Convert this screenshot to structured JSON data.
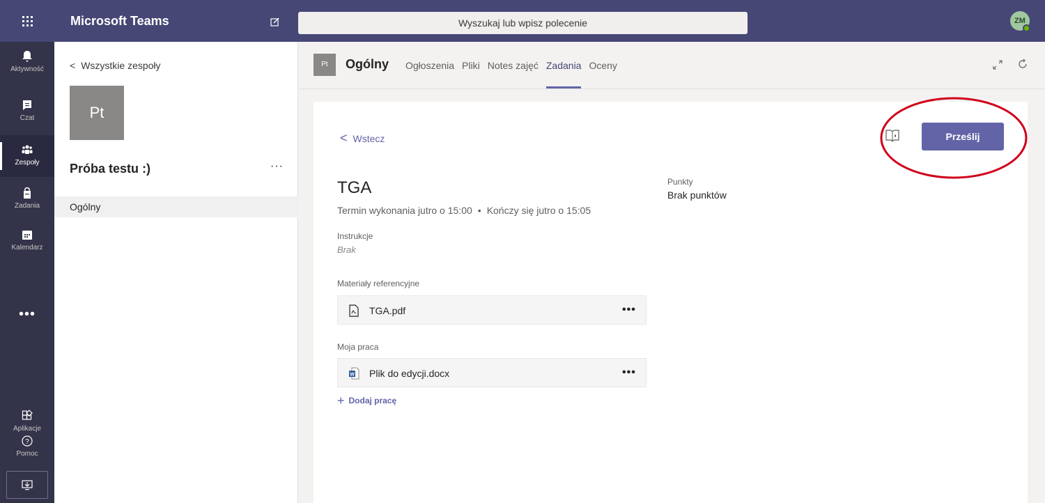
{
  "app": {
    "name": "Microsoft Teams",
    "search_placeholder": "Wyszukaj lub wpisz polecenie",
    "user_initials": "ZM"
  },
  "rail": {
    "items": [
      {
        "label": "Aktywność",
        "icon": "bell-icon"
      },
      {
        "label": "Czat",
        "icon": "chat-icon"
      },
      {
        "label": "Zespoły",
        "icon": "teams-icon",
        "active": true
      },
      {
        "label": "Zadania",
        "icon": "assignments-icon"
      },
      {
        "label": "Kalendarz",
        "icon": "calendar-icon"
      }
    ],
    "more": "•••",
    "bottom": [
      {
        "label": "Aplikacje",
        "icon": "apps-icon"
      },
      {
        "label": "Pomoc",
        "icon": "help-icon"
      }
    ]
  },
  "teams_panel": {
    "back_label": "Wszystkie zespoły",
    "team_tile": "Pt",
    "team_name": "Próba testu :)",
    "more": "···",
    "channel": "Ogólny"
  },
  "channel_header": {
    "icon_text": "Pt",
    "title": "Ogólny",
    "tabs": [
      {
        "label": "Ogłoszenia"
      },
      {
        "label": "Pliki"
      },
      {
        "label": "Notes zajęć"
      },
      {
        "label": "Zadania",
        "active": true
      },
      {
        "label": "Oceny"
      }
    ]
  },
  "assignment": {
    "back_label": "Wstecz",
    "submit_label": "Prześlij",
    "title": "TGA",
    "due": "Termin wykonania jutro o 15:00",
    "dot": "•",
    "closes": "Kończy się jutro o 15:05",
    "points_label": "Punkty",
    "points_value": "Brak punktów",
    "instructions_label": "Instrukcje",
    "instructions_value": "Brak",
    "reference_label": "Materiały referencyjne",
    "reference_files": [
      {
        "name": "TGA.pdf",
        "icon": "pdf-file-icon"
      }
    ],
    "my_work_label": "Moja praca",
    "my_work_files": [
      {
        "name": "Plik do edycji.docx",
        "icon": "word-file-icon"
      }
    ],
    "add_work_label": "Dodaj pracę",
    "file_more": "•••"
  },
  "colors": {
    "topbar": "#464775",
    "rail": "#33344a",
    "accent": "#6264a7",
    "annotation": "#d0021b"
  }
}
